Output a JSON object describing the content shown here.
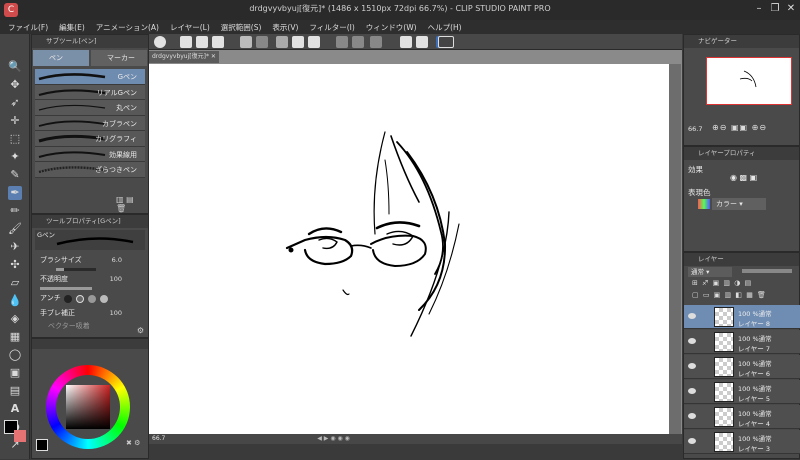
{
  "window": {
    "title": "drdgvyvbyuj[復元]* (1486 x 1510px 72dpi 66.7%) - CLIP STUDIO PAINT PRO"
  },
  "menu": [
    "ファイル(F)",
    "編集(E)",
    "アニメーション(A)",
    "レイヤー(L)",
    "選択範囲(S)",
    "表示(V)",
    "フィルター(I)",
    "ウィンドウ(W)",
    "ヘルプ(H)"
  ],
  "doc_tab": "drdgvyvbyuj[復元]*",
  "subtool": {
    "header": "サブツール[ペン]",
    "tabs": [
      "ペン",
      "マーカー"
    ],
    "brushes": [
      "Gペン",
      "リアルGペン",
      "丸ペン",
      "カブラペン",
      "カリグラフィ",
      "効果線用",
      "ざらつきペン"
    ]
  },
  "tool_property": {
    "header": "ツールプロパティ[Gペン]",
    "brush_name": "Gペン",
    "brush_size_label": "ブラシサイズ",
    "brush_size": "6.0",
    "opacity_label": "不透明度",
    "opacity": "100",
    "opacity_fraction": 1.0,
    "antialias_label": "アンチ",
    "stabilization_label": "手ブレ補正",
    "stabilization": "100",
    "vector_label": "ベクター吸着"
  },
  "status": {
    "zoom": "66.7"
  },
  "navigator": {
    "header": "ナビゲーター",
    "zoom": "66.7"
  },
  "layer_property": {
    "header": "レイヤープロパティ",
    "effect_label": "効果",
    "expression_color_label": "表現色",
    "color_mode": "カラー"
  },
  "layers": {
    "header": "レイヤー",
    "blend_mode": "通常",
    "items": [
      {
        "opacity": "100 %通常",
        "name": "レイヤー 8"
      },
      {
        "opacity": "100 %通常",
        "name": "レイヤー 7"
      },
      {
        "opacity": "100 %通常",
        "name": "レイヤー 6"
      },
      {
        "opacity": "100 %通常",
        "name": "レイヤー 5"
      },
      {
        "opacity": "100 %通常",
        "name": "レイヤー 4"
      },
      {
        "opacity": "100 %通常",
        "name": "レイヤー 3"
      }
    ]
  },
  "colors": {
    "main": "#000000",
    "sub": "#ffffff",
    "accent": "#6e8bb0"
  }
}
